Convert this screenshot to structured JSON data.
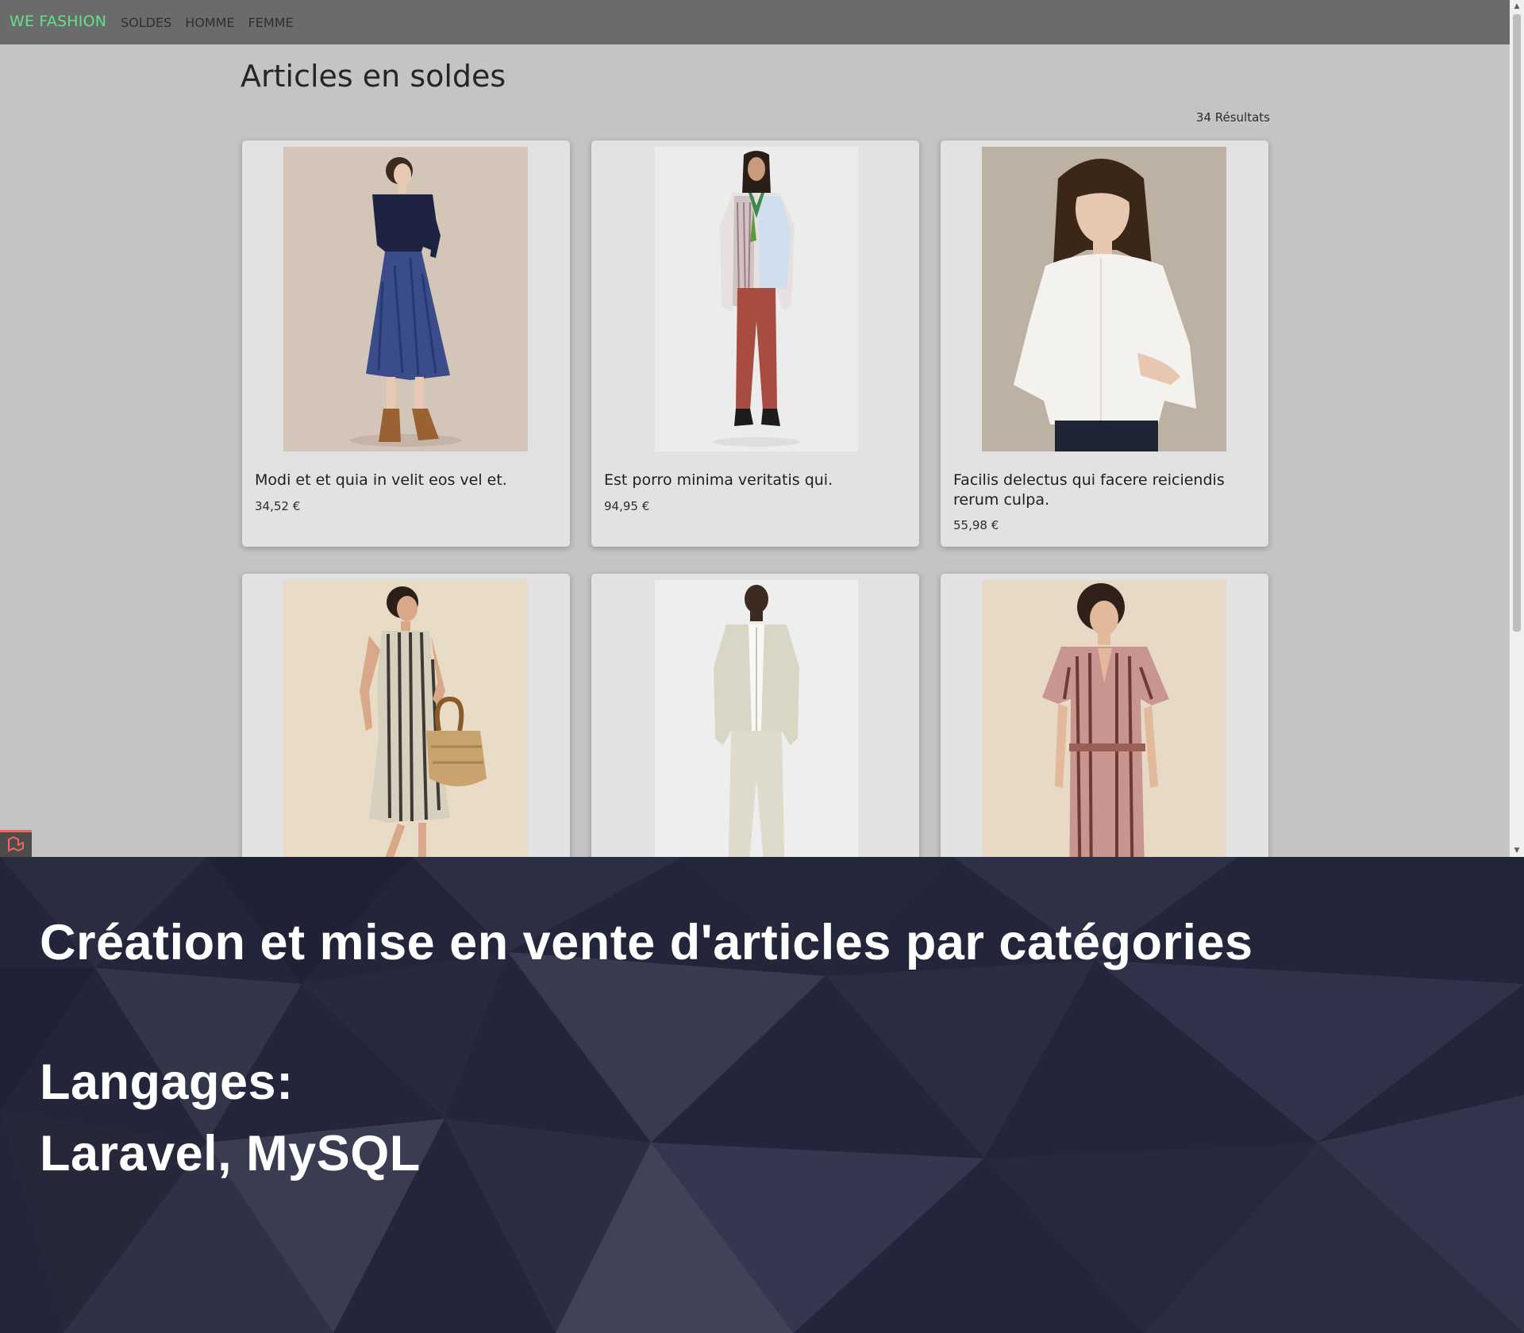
{
  "nav": {
    "brand": "WE FASHION",
    "links": [
      "SOLDES",
      "HOMME",
      "FEMME"
    ]
  },
  "main": {
    "title": "Articles en soldes",
    "result_count": "34 Résultats"
  },
  "products": [
    {
      "name": "Modi et et quia in velit eos vel et.",
      "price": "34,52 €"
    },
    {
      "name": "Est porro minima veritatis qui.",
      "price": "94,95 €"
    },
    {
      "name": "Facilis delectus qui facere reiciendis rerum culpa.",
      "price": "55,98 €"
    },
    {
      "name": "",
      "price": ""
    },
    {
      "name": "",
      "price": ""
    },
    {
      "name": "",
      "price": ""
    }
  ],
  "overlay": {
    "heading": "Création et mise en vente d'articles par catégories",
    "languages_label": "Langages:",
    "languages": "Laravel, MySQL"
  },
  "colors": {
    "brand": "#5fe38a",
    "navbar": "#6b6b6b",
    "page_background": "#c4c4c4",
    "card": "#e2e2e2",
    "overlay": "#23253a"
  },
  "icons": {
    "debugbar": "laravel-logo-icon",
    "scroll_up": "scroll-up-arrow-icon",
    "scroll_down": "scroll-down-arrow-icon"
  }
}
